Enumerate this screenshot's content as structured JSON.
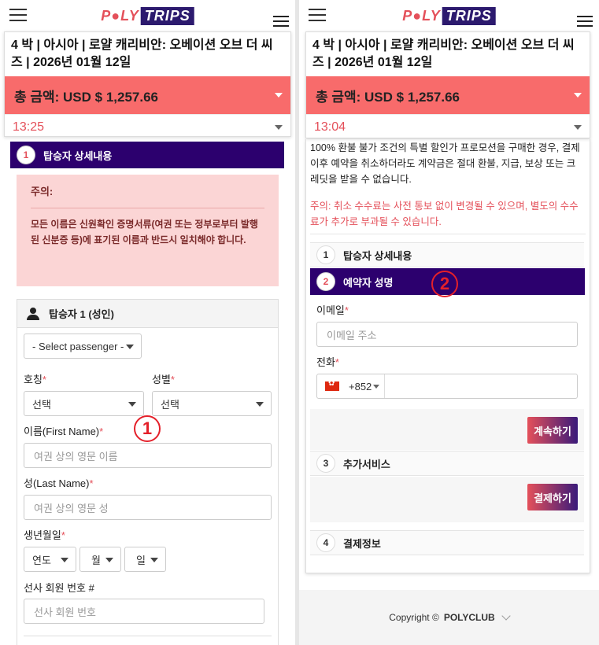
{
  "brand": {
    "part1": "P●LY",
    "part2": "TRIPS"
  },
  "trip": {
    "title": "4 박 | 아시아 | 로얄 캐리비안: 오베이션 오브 더 씨즈 | 2026년 01월 12일",
    "total_label": "총 금액: USD $ 1,257.66"
  },
  "left": {
    "timer": "13:25",
    "step1": {
      "num": "1",
      "label": "탑승자 상세내용"
    },
    "notice": {
      "title": "주의:",
      "body": "모든 이름은 신원확인 증명서류(여권 또는 정부로부터 발행된 신분증 등)에 표기된 이름과 반드시 일치해야 합니다."
    },
    "passenger": {
      "heading": "탑승자 1 (성인)",
      "select_passenger": "- Select passenger -",
      "title_label": "호칭",
      "gender_label": "성별",
      "title_value": "선택",
      "gender_value": "선택",
      "first_name_label": "이름(First Name)",
      "first_name_placeholder": "여권 상의 영문 이름",
      "last_name_label": "성(Last Name)",
      "last_name_placeholder": "여권 상의 영문 성",
      "dob_label": "생년월일",
      "year": "연도",
      "month": "월",
      "day": "일",
      "member_label": "선사 회원 번호 #",
      "member_placeholder": "선사 회원 번호"
    },
    "marker": "1"
  },
  "right": {
    "timer": "13:04",
    "policy": "100% 환불 불가 조건의 특별 할인가 프로모션을 구매한 경우, 결제 이후 예약을 취소하더라도 계약금은 절대 환불, 지급, 보상 또는 크레딧을 받을 수 없습니다.",
    "policy_warn": "주의: 취소 수수료는 사전 통보 없이 변경될 수 있으며, 별도의 수수료가 추가로 부과될 수 있습니다.",
    "step1": {
      "num": "1",
      "label": "탑승자 상세내용"
    },
    "step2": {
      "num": "2",
      "label": "예약자 성명"
    },
    "email_label": "이메일",
    "email_placeholder": "이메일 주소",
    "phone_label": "전화",
    "phone_code": "+852",
    "continue_button": "계속하기",
    "step3": {
      "num": "3",
      "label": "추가서비스"
    },
    "pay_button": "결제하기",
    "step4": {
      "num": "4",
      "label": "결제정보"
    },
    "marker": "2",
    "footer": {
      "copyright": "Copyright ©",
      "brand": "POLYCLUB"
    }
  },
  "colors": {
    "accent": "#e4505a",
    "step_bg": "#2c006e",
    "total_bg": "#f86b6b",
    "notice_bg": "#fbd5d5"
  }
}
